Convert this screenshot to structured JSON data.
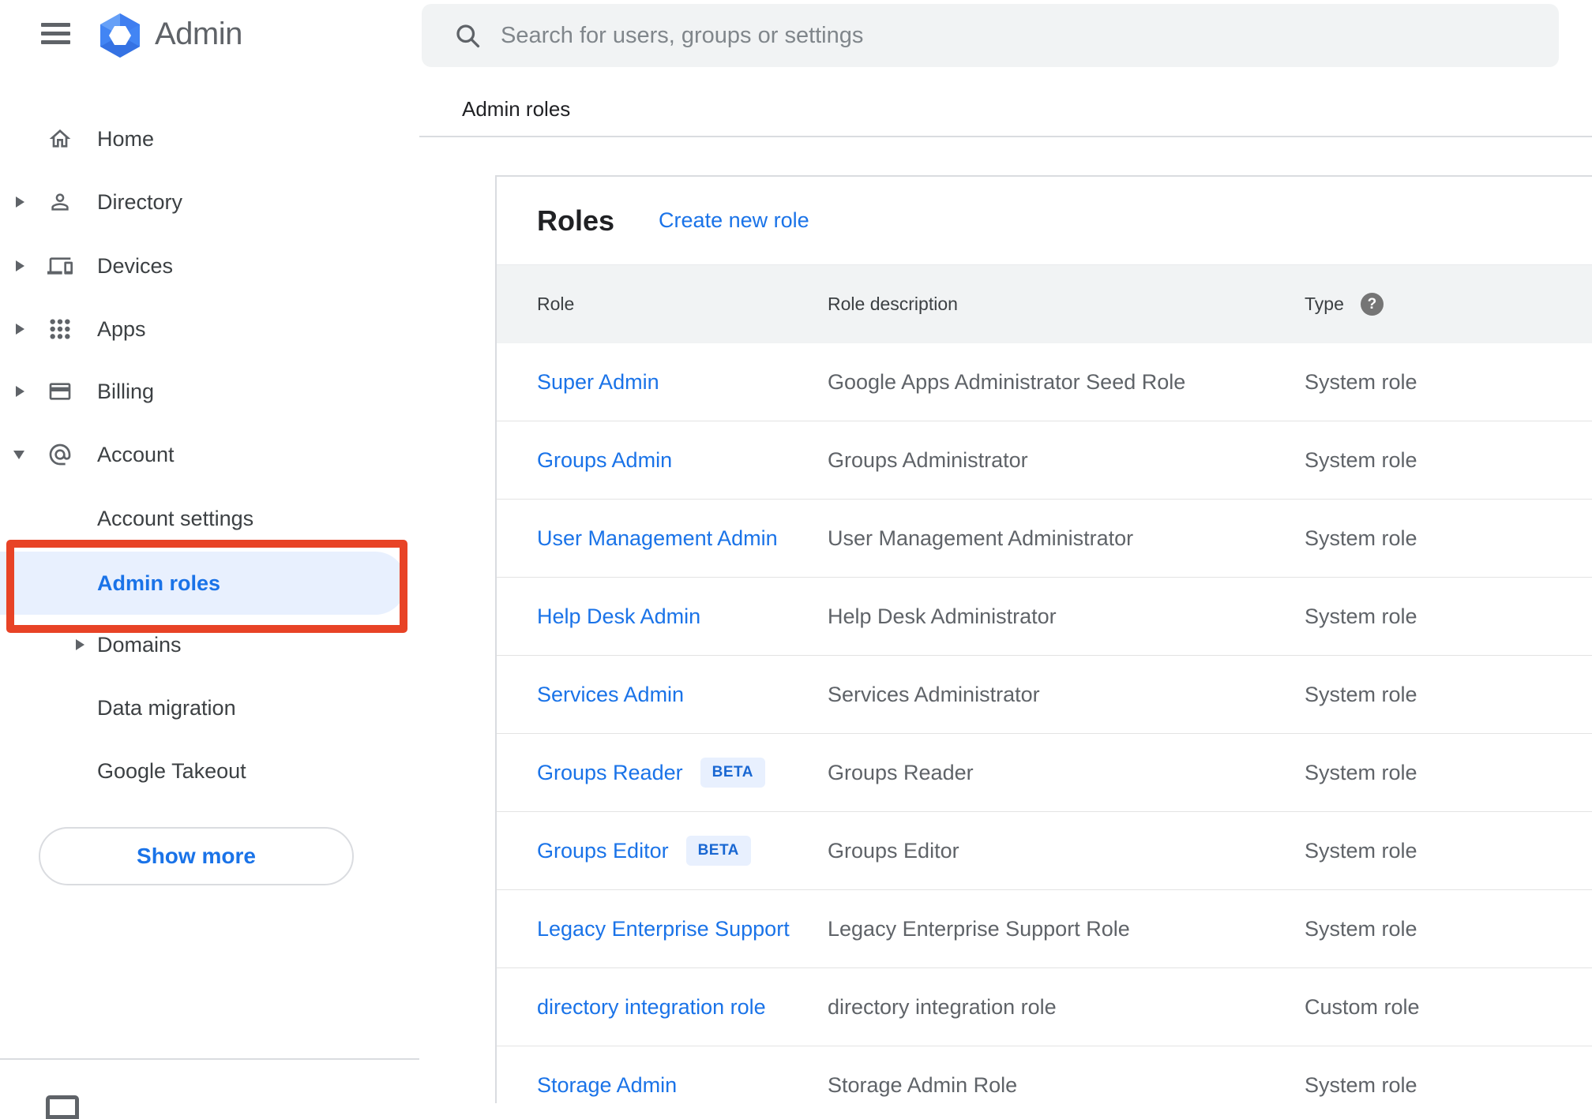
{
  "topbar": {
    "app_name": "Admin",
    "search_placeholder": "Search for users, groups or settings",
    "menu_icon": "hamburger-menu-icon",
    "logo_icon": "google-admin-hexagon-logo",
    "search_icon": "search-icon"
  },
  "breadcrumb": "Admin roles",
  "sidebar": {
    "items": [
      {
        "label": "Home",
        "icon": "home-icon",
        "expandable": false
      },
      {
        "label": "Directory",
        "icon": "person-icon",
        "expandable": true
      },
      {
        "label": "Devices",
        "icon": "devices-icon",
        "expandable": true
      },
      {
        "label": "Apps",
        "icon": "apps-grid-icon",
        "expandable": true
      },
      {
        "label": "Billing",
        "icon": "credit-card-icon",
        "expandable": true
      },
      {
        "label": "Account",
        "icon": "at-sign-icon",
        "expandable": true,
        "expanded": true
      }
    ],
    "account_children": [
      {
        "label": "Account settings"
      },
      {
        "label": "Admin roles",
        "active": true,
        "annotated": "red-highlight-box"
      },
      {
        "label": "Domains",
        "expandable": true
      },
      {
        "label": "Data migration"
      },
      {
        "label": "Google Takeout"
      }
    ],
    "show_more_label": "Show more"
  },
  "content": {
    "title": "Roles",
    "create_link": "Create new role",
    "table": {
      "columns": [
        "Role",
        "Role description",
        "Type"
      ],
      "type_help_icon": "help-question-icon",
      "rows": [
        {
          "role": "Super Admin",
          "description": "Google Apps Administrator Seed Role",
          "type": "System role"
        },
        {
          "role": "Groups Admin",
          "description": "Groups Administrator",
          "type": "System role"
        },
        {
          "role": "User Management Admin",
          "description": "User Management Administrator",
          "type": "System role"
        },
        {
          "role": "Help Desk Admin",
          "description": "Help Desk Administrator",
          "type": "System role"
        },
        {
          "role": "Services Admin",
          "description": "Services Administrator",
          "type": "System role"
        },
        {
          "role": "Groups Reader",
          "badge": "BETA",
          "description": "Groups Reader",
          "type": "System role"
        },
        {
          "role": "Groups Editor",
          "badge": "BETA",
          "description": "Groups Editor",
          "type": "System role"
        },
        {
          "role": "Legacy Enterprise Support",
          "description": "Legacy Enterprise Support Role",
          "type": "System role"
        },
        {
          "role": "directory integration role",
          "description": "directory integration role",
          "type": "Custom role"
        },
        {
          "role": "Storage Admin",
          "description": "Storage Admin Role",
          "type": "System role"
        }
      ]
    }
  },
  "colors": {
    "link_blue": "#1a73e8",
    "active_item_bg": "#e8f0fe",
    "annotation_red": "#e84326",
    "table_header_bg": "#f1f3f4",
    "search_bg": "#f1f3f4",
    "beta_badge_bg": "#e8f0fe",
    "beta_badge_text": "#1967d2",
    "icon_gray": "#5f6368",
    "text_dark": "#202124"
  }
}
